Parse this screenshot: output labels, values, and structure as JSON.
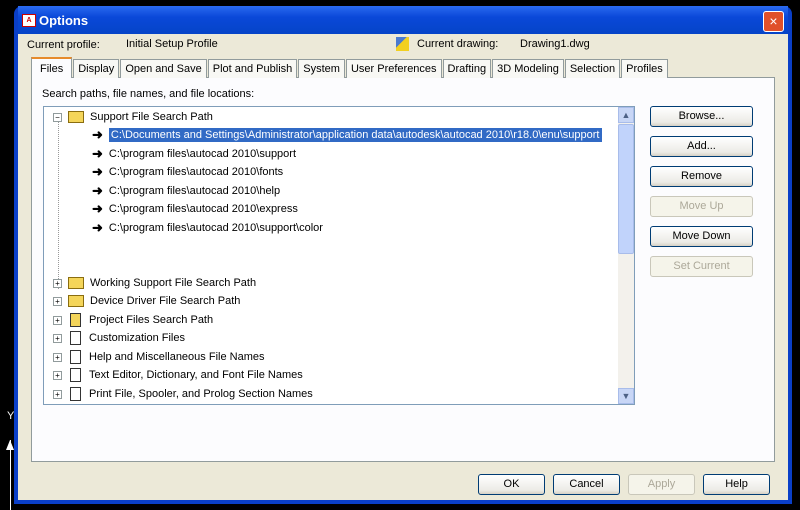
{
  "window": {
    "title": "Options",
    "app_icon": "autocad-icon",
    "close": "×"
  },
  "header": {
    "current_profile_label": "Current profile:",
    "current_profile": "Initial Setup Profile",
    "current_drawing_label": "Current drawing:",
    "current_drawing": "Drawing1.dwg"
  },
  "tabs": [
    "Files",
    "Display",
    "Open and Save",
    "Plot and Publish",
    "System",
    "User Preferences",
    "Drafting",
    "3D Modeling",
    "Selection",
    "Profiles"
  ],
  "files": {
    "section_label": "Search paths, file names, and file locations:",
    "tree": {
      "expanded": "Support File Search Path",
      "paths": [
        "C:\\Documents and Settings\\Administrator\\application data\\autodesk\\autocad 2010\\r18.0\\enu\\support",
        "C:\\program files\\autocad 2010\\support",
        "C:\\program files\\autocad 2010\\fonts",
        "C:\\program files\\autocad 2010\\help",
        "C:\\program files\\autocad 2010\\express",
        "C:\\program files\\autocad 2010\\support\\color"
      ],
      "collapsed": [
        "Working Support File Search Path",
        "Device Driver File Search Path",
        "Project Files Search Path",
        "Customization Files",
        "Help and Miscellaneous File Names",
        "Text Editor, Dictionary, and Font File Names",
        "Print File, Spooler, and Prolog Section Names"
      ]
    },
    "buttons": [
      "Browse...",
      "Add...",
      "Remove",
      "Move Up",
      "Move Down",
      "Set Current"
    ]
  },
  "footer": {
    "ok": "OK",
    "cancel": "Cancel",
    "apply": "Apply",
    "help": "Help"
  },
  "ucs": {
    "y_label": "Y"
  }
}
